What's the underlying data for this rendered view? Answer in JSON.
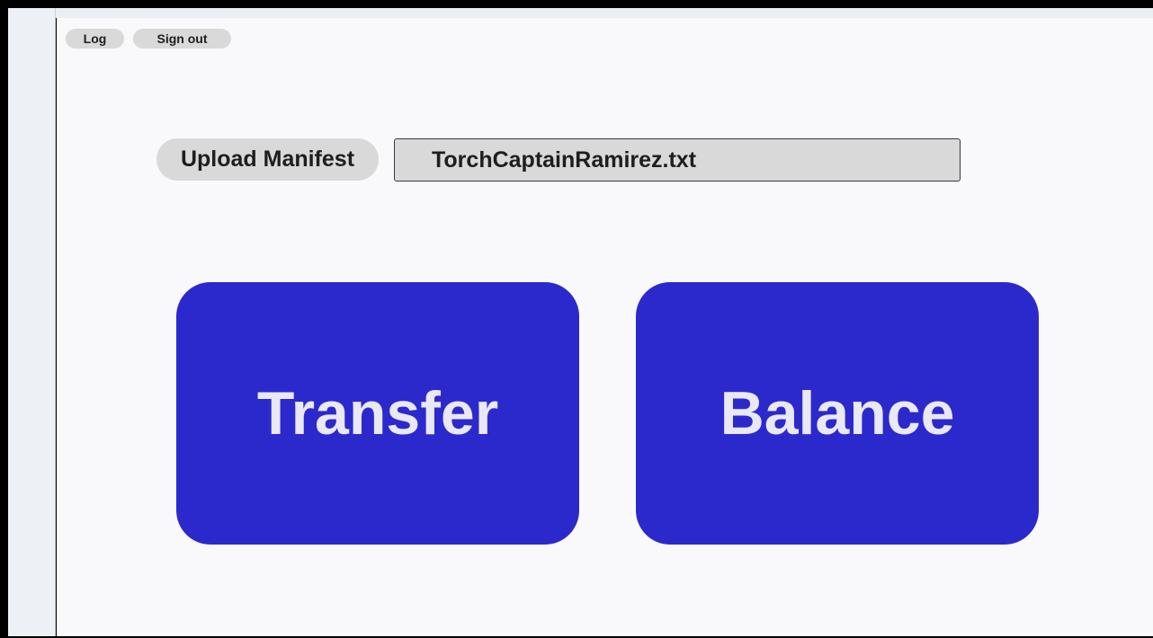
{
  "header": {
    "log_label": "Log",
    "signout_label": "Sign out"
  },
  "manifest": {
    "upload_label": "Upload Manifest",
    "filename": "TorchCaptainRamirez.txt"
  },
  "actions": {
    "transfer_label": "Transfer",
    "balance_label": "Balance"
  },
  "colors": {
    "primary_button": "#2c29cc",
    "primary_button_text": "#e9e8f6",
    "pill_background": "#d9d9d9",
    "page_background": "#f9f9fb"
  }
}
